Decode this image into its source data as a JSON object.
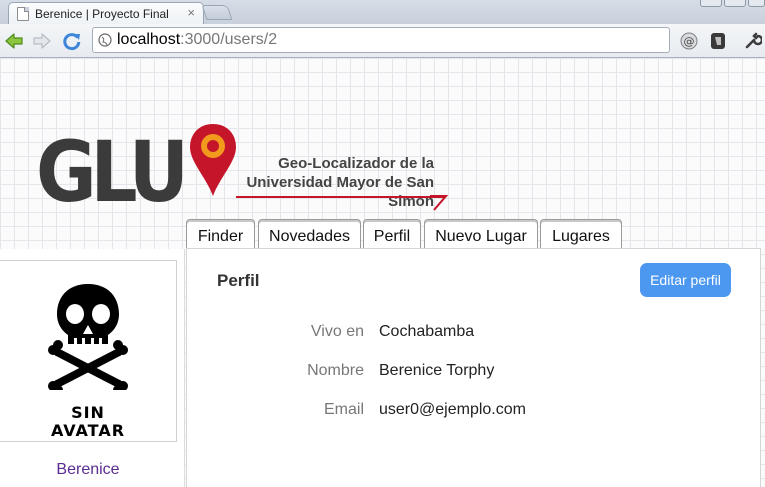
{
  "browser": {
    "tab_title": "Berenice | Proyecto Final",
    "tab_close": "×",
    "url_host": "localhost",
    "url_path": ":3000/users/2"
  },
  "site": {
    "logo_text": "GLU",
    "tagline_line1": "Geo-Localizador de la",
    "tagline_line2": "Universidad Mayor de San Simon",
    "brand_red": "#c4152a",
    "pin_inner": "#f29a1d"
  },
  "nav": {
    "tabs": [
      {
        "label": "Finder"
      },
      {
        "label": "Novedades"
      },
      {
        "label": "Perfil"
      },
      {
        "label": "Nuevo Lugar"
      },
      {
        "label": "Lugares"
      }
    ]
  },
  "sidebar": {
    "avatar_line1": "SIN",
    "avatar_line2": "AVATAR",
    "user_name": "Berenice"
  },
  "profile": {
    "title": "Perfil",
    "edit_button": "Editar perfil",
    "accent": "#4c97f0",
    "fields": [
      {
        "label": "Vivo en",
        "value": "Cochabamba"
      },
      {
        "label": "Nombre",
        "value": "Berenice Torphy"
      },
      {
        "label": "Email",
        "value": "user0@ejemplo.com"
      }
    ]
  }
}
